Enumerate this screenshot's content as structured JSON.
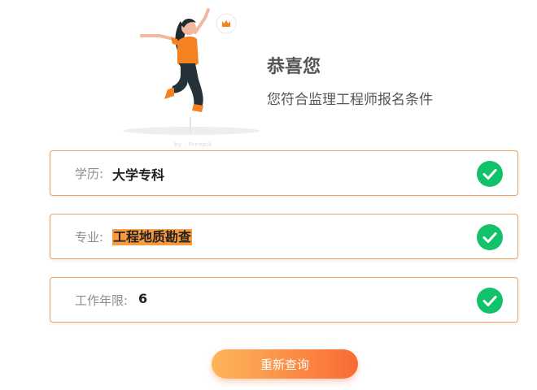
{
  "header": {
    "title": "恭喜您",
    "subtitle": "您符合监理工程师报名条件"
  },
  "illustration": {
    "icon": "jumping-person-illustration",
    "badge_icon": "crown-icon",
    "watermark": "by : Freepik"
  },
  "conditions": [
    {
      "label": "学历:",
      "value": "大学专科",
      "status_icon": "check-circle-icon",
      "highlighted": false
    },
    {
      "label": "专业:",
      "value": "工程地质勘查",
      "status_icon": "check-circle-icon",
      "highlighted": true
    },
    {
      "label": "工作年限:",
      "value": "6",
      "status_icon": "check-circle-icon",
      "highlighted": false
    }
  ],
  "actions": {
    "requery_label": "重新查询"
  },
  "colors": {
    "accent": "#fc8d45",
    "card_border": "#f2a15c",
    "success": "#12c26a",
    "highlight": "#fb9a3c"
  }
}
